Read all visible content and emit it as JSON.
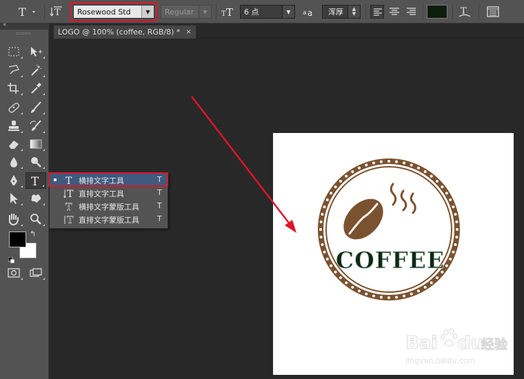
{
  "options_bar": {
    "tool_icon": "type-tool-icon",
    "orientation_icon": "text-orientation-icon",
    "font_family": "Rosewood Std",
    "font_style": "Regular",
    "font_size_icon": "font-size-icon",
    "font_size": "6 点",
    "antialias_icon": "antialias-icon",
    "antialias": "浑厚",
    "align_icons": [
      "align-left-icon",
      "align-center-icon",
      "align-right-icon"
    ],
    "text_color": "#0c1e0c",
    "warp_icon": "warp-text-icon",
    "panels_icon": "character-panels-icon"
  },
  "document": {
    "tab_title": "LOGO @ 100% (coffee, RGB/8) *",
    "tab_close": "×"
  },
  "tools_flyout": {
    "items": [
      {
        "label": "横排文字工具",
        "shortcut": "T",
        "selected": true
      },
      {
        "label": "直排文字工具",
        "shortcut": "T",
        "selected": false
      },
      {
        "label": "横排文字蒙版工具",
        "shortcut": "T",
        "selected": false
      },
      {
        "label": "直排文字蒙版工具",
        "shortcut": "T",
        "selected": false
      }
    ]
  },
  "logo": {
    "text": "COFFEE",
    "brown": "#7b5230",
    "dark_green": "#0d2a18"
  },
  "watermark": {
    "brand": "Bai",
    "brand2": "du",
    "cn": "经验",
    "url": "jingyan.baidu.com"
  },
  "colors": {
    "highlight": "#e0142a",
    "foreground": "#000000",
    "background": "#ffffff"
  }
}
